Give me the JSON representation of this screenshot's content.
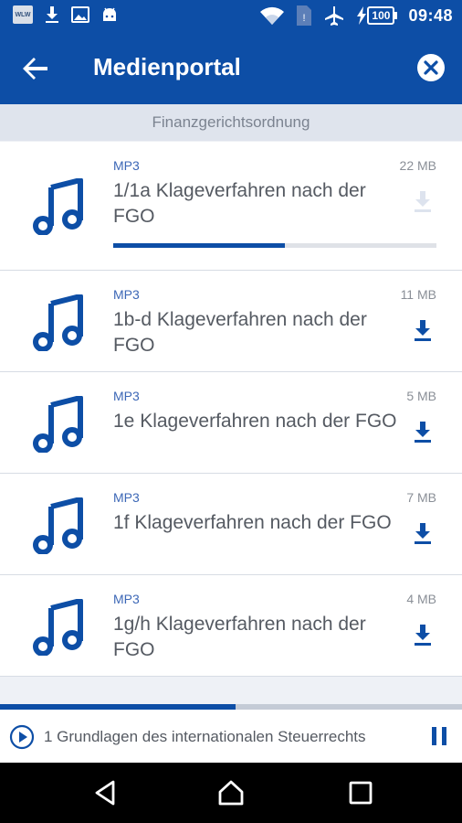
{
  "status_bar": {
    "app_badge": "WLW",
    "battery": "100",
    "time": "09:48"
  },
  "app_bar": {
    "title": "Medienportal"
  },
  "section": {
    "header": "Finanzgerichtsordnung"
  },
  "items": [
    {
      "format": "MP3",
      "size": "22 MB",
      "title": "1/1a Klageverfahren nach der FGO",
      "downloading": true,
      "progress": 0.53
    },
    {
      "format": "MP3",
      "size": "11 MB",
      "title": "1b-d Klageverfahren nach der FGO",
      "downloading": false
    },
    {
      "format": "MP3",
      "size": "5 MB",
      "title": "1e Klageverfahren nach der FGO",
      "downloading": false
    },
    {
      "format": "MP3",
      "size": "7 MB",
      "title": "1f Klageverfahren nach der FGO",
      "downloading": false
    },
    {
      "format": "MP3",
      "size": "4 MB",
      "title": "1g/h Klageverfahren nach der FGO",
      "downloading": false
    }
  ],
  "player": {
    "now_playing": "1 Grundlagen des internationalen Steuerrechts",
    "progress": 0.51
  },
  "colors": {
    "primary": "#0d4ea6",
    "accent_text": "#3c67b6"
  },
  "icons": {
    "back": "arrow-left-icon",
    "close": "close-circle-icon",
    "item": "music-note-icon",
    "download": "download-icon",
    "play": "play-circle-icon",
    "pause": "pause-icon"
  }
}
